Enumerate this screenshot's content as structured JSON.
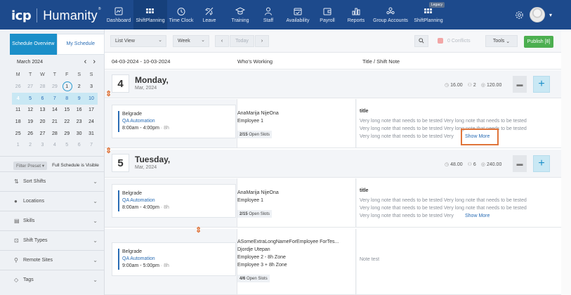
{
  "brand": {
    "company": "icp",
    "product": "Humanity",
    "trademark": "®"
  },
  "nav": [
    {
      "label": "Dashboard",
      "icon": "dashboard-icon"
    },
    {
      "label": "ShiftPlanning",
      "icon": "grid-icon"
    },
    {
      "label": "Time Clock",
      "icon": "clock-icon"
    },
    {
      "label": "Leave",
      "icon": "plane-icon"
    },
    {
      "label": "Training",
      "icon": "graduation-cap-icon"
    },
    {
      "label": "Staff",
      "icon": "user-icon"
    },
    {
      "label": "Availability",
      "icon": "calendar-check-icon"
    },
    {
      "label": "Payroll",
      "icon": "wallet-icon"
    },
    {
      "label": "Reports",
      "icon": "bar-chart-icon"
    },
    {
      "label": "Group Accounts",
      "icon": "group-icon"
    },
    {
      "label": "ShiftPlanning",
      "icon": "grid-icon",
      "badge": "Legacy"
    }
  ],
  "sidebar": {
    "tabs": [
      {
        "label": "Schedule Overview"
      },
      {
        "label": "My Schedule"
      }
    ],
    "calendar": {
      "month": "March 2024",
      "dow": [
        "M",
        "T",
        "W",
        "T",
        "F",
        "S",
        "S"
      ],
      "weeks": [
        [
          "26",
          "27",
          "28",
          "29",
          "1",
          "2",
          "3"
        ],
        [
          "4",
          "5",
          "6",
          "7",
          "8",
          "9",
          "10"
        ],
        [
          "11",
          "12",
          "13",
          "14",
          "15",
          "16",
          "17"
        ],
        [
          "18",
          "19",
          "20",
          "21",
          "22",
          "23",
          "24"
        ],
        [
          "25",
          "26",
          "27",
          "28",
          "29",
          "30",
          "31"
        ],
        [
          "1",
          "2",
          "3",
          "4",
          "5",
          "6",
          "7"
        ]
      ]
    },
    "filter_preset": "Filter Preset",
    "filter_visibility": "Full Schedule is Visible",
    "sections": [
      {
        "label": "Sort Shifts",
        "icon": "sort-icon"
      },
      {
        "label": "Locations",
        "icon": "location-pin-icon"
      },
      {
        "label": "Skills",
        "icon": "skills-icon"
      },
      {
        "label": "Shift Types",
        "icon": "shift-types-icon"
      },
      {
        "label": "Remote Sites",
        "icon": "remote-site-icon"
      },
      {
        "label": "Tags",
        "icon": "tag-icon"
      }
    ]
  },
  "toolbar": {
    "view": "List View",
    "range": "Week",
    "prev": "‹",
    "today": "Today",
    "next": "›",
    "conflicts": "0 Conflicts",
    "tools": "Tools",
    "publish": "Publish [8]"
  },
  "table": {
    "date_range": "04-03-2024 - 10-03-2024",
    "col_working": "Who's Working",
    "col_note": "Title / Shift Note"
  },
  "days": [
    {
      "num": "4",
      "name": "Monday,",
      "month": "Mar, 2024",
      "hours": "16.00",
      "people": "2",
      "cost": "120.00"
    },
    {
      "num": "5",
      "name": "Tuesday,",
      "month": "Mar, 2024",
      "hours": "48.00",
      "people": "6",
      "cost": "240.00"
    }
  ],
  "shifts": [
    {
      "location": "Belgrade",
      "position": "QA Automation",
      "time": "8:00am - 4:00pm",
      "hours": "· 8h",
      "workers": [
        "AnaMarija NijeOna",
        "Employee 1"
      ],
      "open_slots_count": "2/15",
      "open_slots_label": "Open Slots",
      "note_title": "title",
      "note_lines": [
        "Very long note that needs to be tested Very long note that needs to be tested",
        "Very long note that needs to be tested Very long note that needs to be tested",
        "Very long note that needs to be tested Very"
      ],
      "show_more": "Show More"
    },
    {
      "location": "Belgrade",
      "position": "QA Automation",
      "time": "8:00am - 4:00pm",
      "hours": "· 8h",
      "workers": [
        "AnaMarija NijeOna",
        "Employee 1"
      ],
      "open_slots_count": "2/15",
      "open_slots_label": "Open Slots",
      "note_title": "title",
      "note_lines": [
        "Very long note that needs to be tested Very long note that needs to be tested",
        "Very long note that needs to be tested Very long note that needs to be tested",
        "Very long note that needs to be tested Very"
      ],
      "show_more": "Show More"
    },
    {
      "location": "Belgrade",
      "position": "QA Automation",
      "time": "9:00am - 5:00pm",
      "hours": "· 8h",
      "workers": [
        "ASomeExtraLongNameForEmployee ForTes...",
        "Djordje Utepan",
        "Employee 2 - 8h Zone",
        "Employee 3 + 8h Zone"
      ],
      "open_slots_count": "4/6",
      "open_slots_label": "Open Slots",
      "note_plain": "Note test"
    }
  ],
  "colors": {
    "nav_bg": "#1d4a8c",
    "accent": "#1b8fc9",
    "publish": "#4caf50",
    "highlight": "#e0743a"
  }
}
